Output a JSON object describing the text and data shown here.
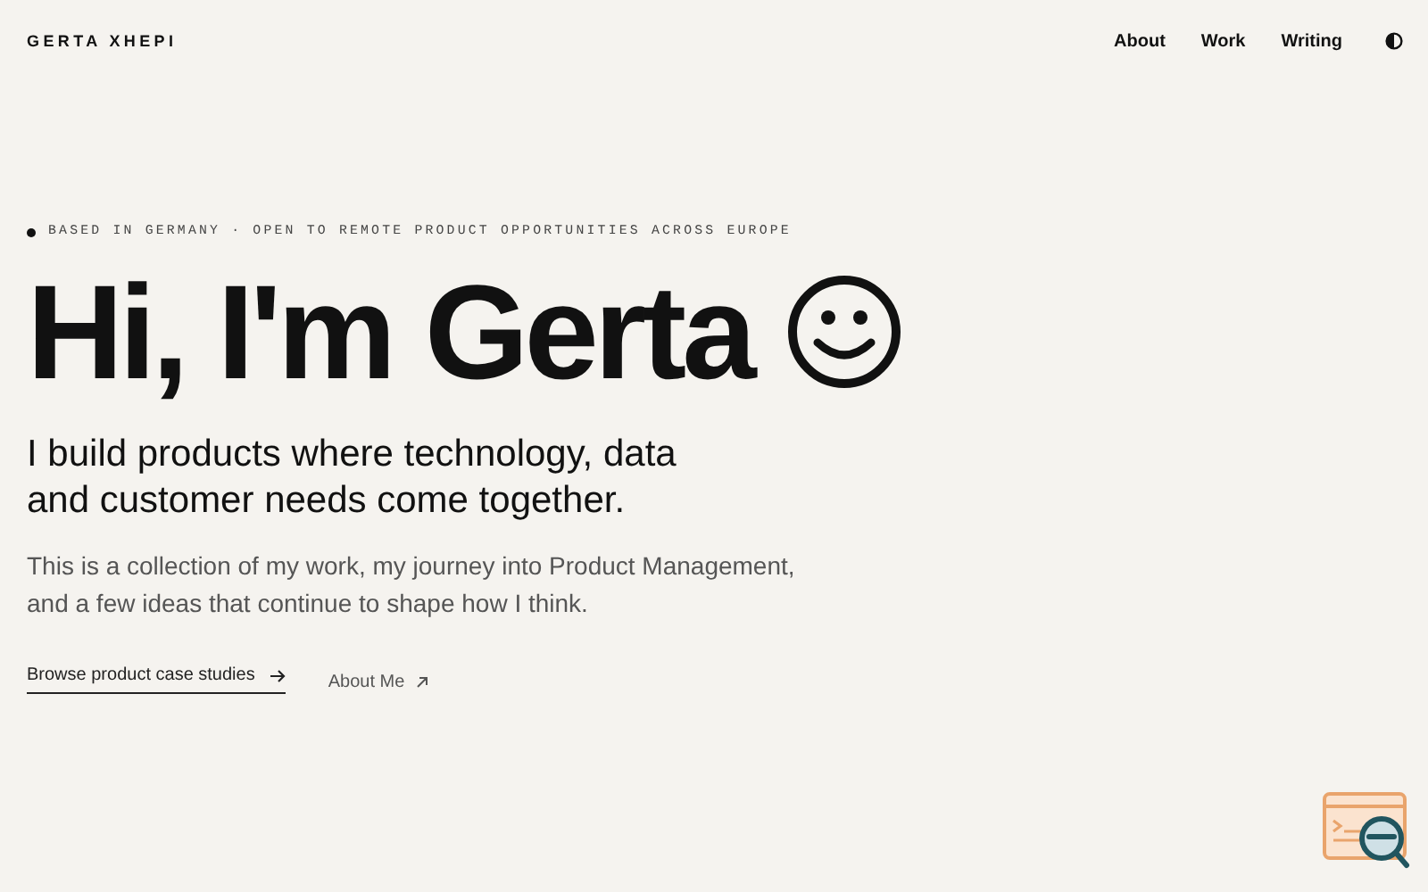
{
  "header": {
    "logo": "GERTA XHEPI",
    "nav": [
      {
        "label": "About"
      },
      {
        "label": "Work"
      },
      {
        "label": "Writing"
      }
    ]
  },
  "hero": {
    "status": "BASED IN GERMANY · OPEN TO REMOTE PRODUCT OPPORTUNITIES ACROSS EUROPE",
    "title": "Hi, I'm Gerta",
    "subtitle": "I build products where technology, data and customer needs come together.",
    "intro": "This is a collection of my work, my journey into Product Management, and a few ideas that continue to shape how I think.",
    "links": [
      {
        "kind": "primary",
        "label": "Browse product case studies"
      },
      {
        "kind": "secondary",
        "label": "About Me"
      }
    ]
  }
}
